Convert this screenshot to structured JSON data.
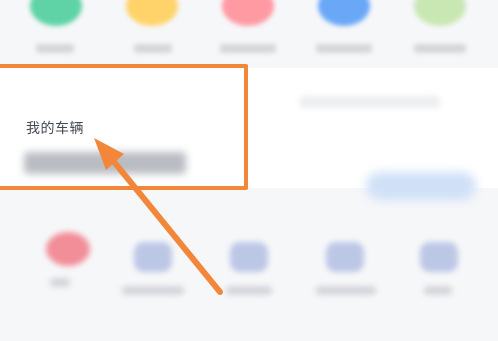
{
  "vehicle_card": {
    "title": "我的车辆"
  },
  "colors": {
    "accent_orange": "#f2873a",
    "icon_green": "#5fd3a5",
    "icon_yellow": "#ffd36a",
    "icon_pink": "#ff9aa2",
    "icon_blue": "#6aa8f7",
    "icon_lightgreen": "#c9e7b3",
    "service_red": "#f28e98",
    "service_blue": "#bcc7e6"
  },
  "icons": {
    "top_row": [
      "green-circle-icon",
      "yellow-circle-icon",
      "pink-circle-icon",
      "blue-circle-icon",
      "light-circle-icon"
    ],
    "annotation": "arrow-icon"
  }
}
